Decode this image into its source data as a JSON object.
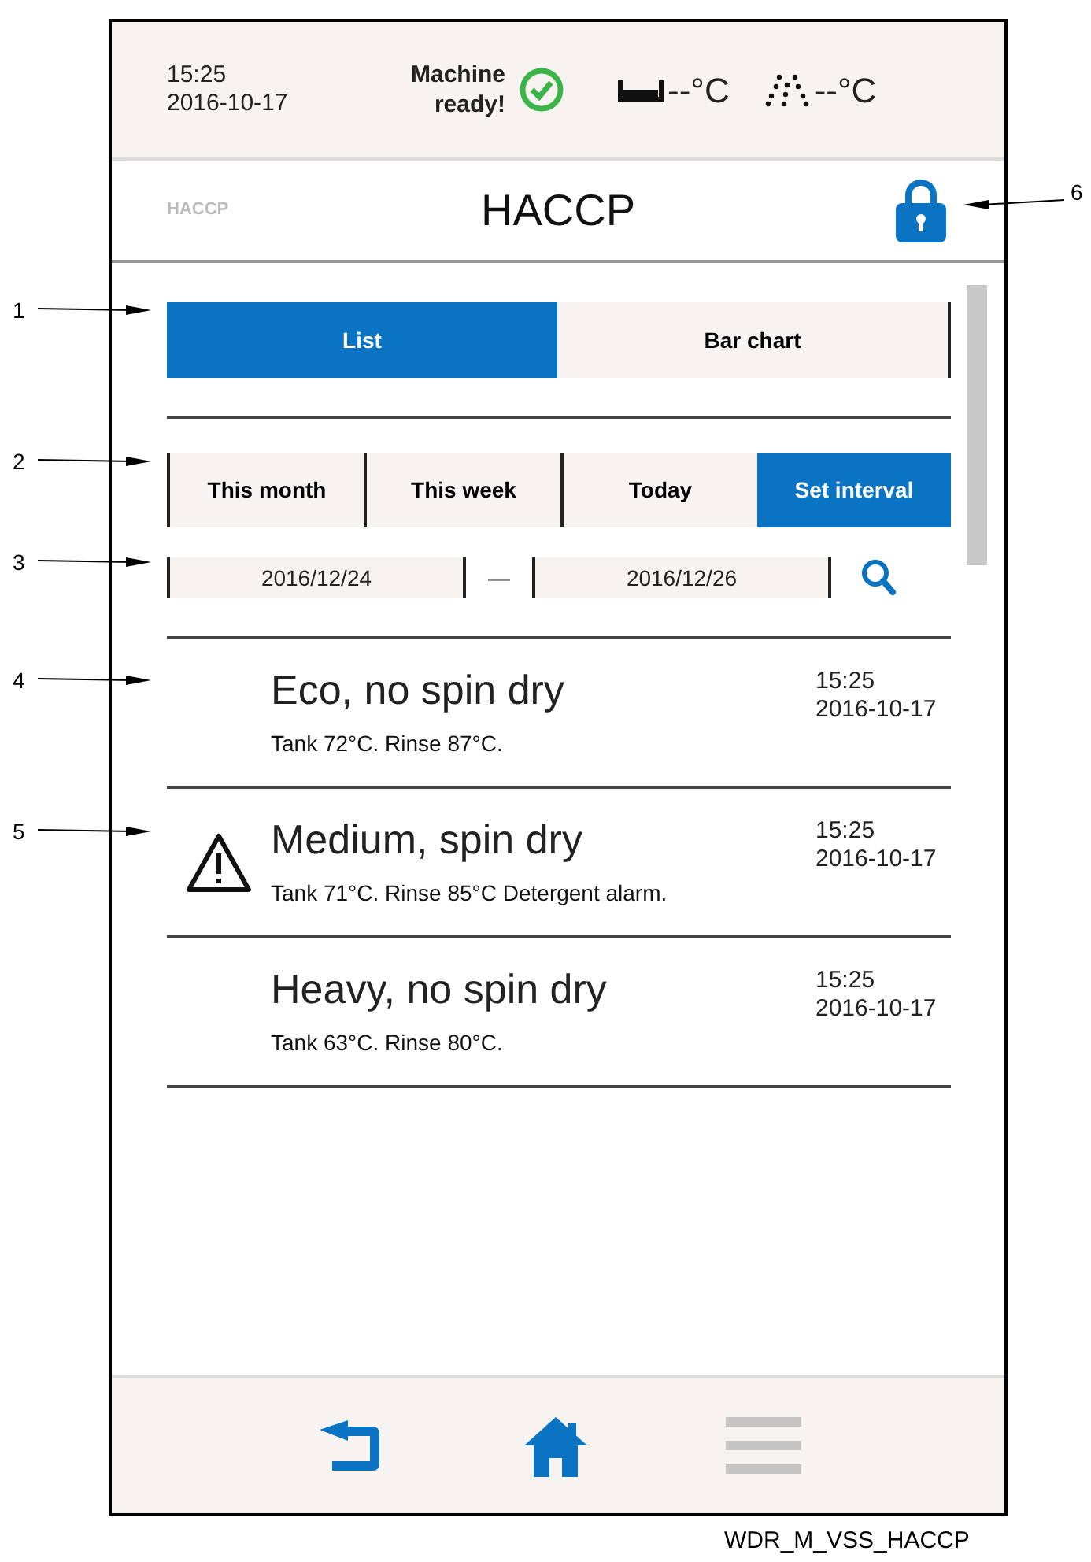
{
  "status_bar": {
    "time": "15:25",
    "date": "2016-10-17",
    "machine_status": "Machine ready!",
    "tank_temp": "--°C",
    "rinse_temp": "--°C"
  },
  "header": {
    "section_label": "HACCP",
    "title": "HACCP"
  },
  "view_tabs": [
    {
      "label": "List",
      "selected": true
    },
    {
      "label": "Bar chart",
      "selected": false
    }
  ],
  "period_tabs": [
    {
      "label": "This month",
      "selected": false
    },
    {
      "label": "This week",
      "selected": false
    },
    {
      "label": "Today",
      "selected": false
    },
    {
      "label": "Set interval",
      "selected": true
    }
  ],
  "date_range": {
    "from": "2016/12/24",
    "separator": "—",
    "to": "2016/12/26"
  },
  "entries": [
    {
      "title": "Eco, no spin dry",
      "time": "15:25",
      "date": "2016-10-17",
      "details": "Tank 72°C. Rinse 87°C.",
      "alarm": false
    },
    {
      "title": "Medium, spin dry",
      "time": "15:25",
      "date": "2016-10-17",
      "details": "Tank 71°C. Rinse 85°C Detergent alarm.",
      "alarm": true
    },
    {
      "title": "Heavy, no spin dry",
      "time": "15:25",
      "date": "2016-10-17",
      "details": "Tank 63°C. Rinse 80°C.",
      "alarm": false
    }
  ],
  "callouts": [
    "1",
    "2",
    "3",
    "4",
    "5",
    "6"
  ],
  "caption": "WDR_M_VSS_HACCP"
}
